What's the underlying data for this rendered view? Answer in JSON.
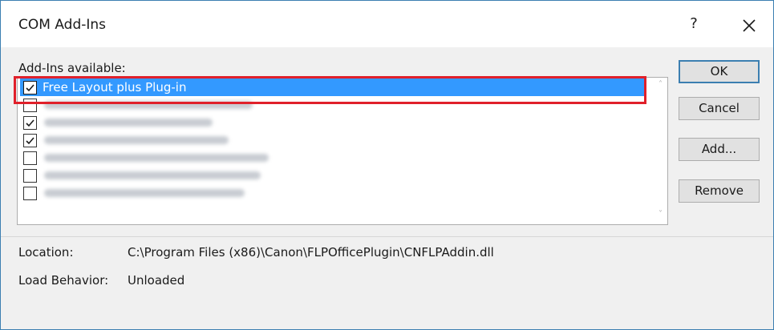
{
  "window": {
    "title": "COM Add-Ins",
    "help_label": "?",
    "close_icon": "close-icon"
  },
  "list": {
    "label": "Add-Ins available:",
    "items": [
      {
        "label": "Free Layout plus Plug-in",
        "checked": true,
        "selected": true
      },
      {
        "label": "",
        "checked": false,
        "selected": false
      },
      {
        "label": "",
        "checked": true,
        "selected": false
      },
      {
        "label": "",
        "checked": true,
        "selected": false
      },
      {
        "label": "",
        "checked": false,
        "selected": false
      },
      {
        "label": "",
        "checked": false,
        "selected": false
      },
      {
        "label": "",
        "checked": false,
        "selected": false
      }
    ]
  },
  "buttons": {
    "ok": "OK",
    "cancel": "Cancel",
    "add": "Add...",
    "remove": "Remove"
  },
  "details": {
    "location_label": "Location:",
    "location_value": "C:\\Program Files (x86)\\Canon\\FLPOfficePlugin\\CNFLPAddin.dll",
    "load_behavior_label": "Load Behavior:",
    "load_behavior_value": "Unloaded"
  },
  "colors": {
    "selection": "#3399ff",
    "highlight_outline": "#e0202a",
    "default_button_border": "#3c7fb1"
  }
}
